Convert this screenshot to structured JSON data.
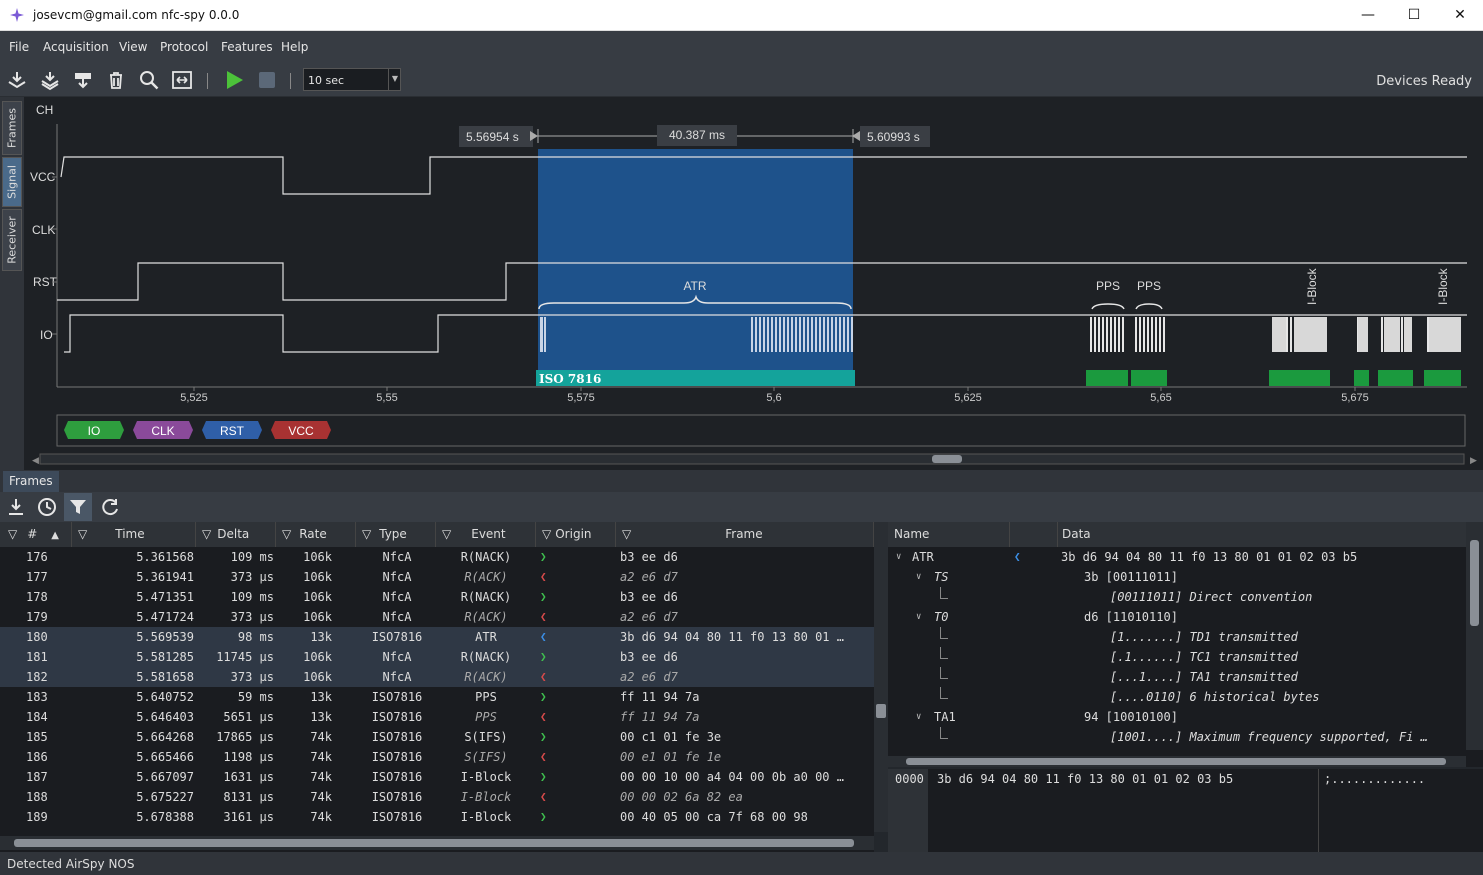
{
  "window": {
    "title": "josevcm@gmail.com nfc-spy 0.0.0"
  },
  "menu": [
    "File",
    "Acquisition",
    "View",
    "Protocol",
    "Features",
    "Help"
  ],
  "toolbar": {
    "duration": "10 sec",
    "status": "Devices Ready"
  },
  "side_tabs": [
    "Frames",
    "Signal",
    "Receiver"
  ],
  "signal": {
    "ch_label": "CH",
    "channels": [
      "VCC",
      "CLK",
      "RST",
      "IO"
    ],
    "marker_left": "5.56954 s",
    "marker_width": "40.387 ms",
    "marker_right": "5.60993 s",
    "atr_label": "ATR",
    "pps_labels": [
      "PPS",
      "PPS"
    ],
    "iblock_labels": [
      "I-Block",
      "I-Block"
    ],
    "protocol_label": "ISO 7816",
    "xticks": [
      "5,525",
      "5,55",
      "5,575",
      "5,6",
      "5,625",
      "5,65",
      "5,675"
    ],
    "legend": [
      "IO",
      "CLK",
      "RST",
      "VCC"
    ]
  },
  "frames_tab": "Frames",
  "table": {
    "headers": [
      "#",
      "Time",
      "Delta",
      "Rate",
      "Type",
      "Event",
      "Origin",
      "Frame"
    ],
    "rows": [
      [
        "176",
        "5.361568",
        "109 ms",
        "106k",
        "NfcA",
        "R(NACK)",
        "rx",
        "b3 ee d6",
        false,
        false
      ],
      [
        "177",
        "5.361941",
        "373 µs",
        "106k",
        "NfcA",
        "R(ACK)",
        "tx",
        "a2 e6 d7",
        true,
        false
      ],
      [
        "178",
        "5.471351",
        "109 ms",
        "106k",
        "NfcA",
        "R(NACK)",
        "rx",
        "b3 ee d6",
        false,
        false
      ],
      [
        "179",
        "5.471724",
        "373 µs",
        "106k",
        "NfcA",
        "R(ACK)",
        "tx",
        "a2 e6 d7",
        true,
        false
      ],
      [
        "180",
        "5.569539",
        "98 ms",
        "13k",
        "ISO7816",
        "ATR",
        "atr",
        "3b d6 94 04 80 11 f0 13 80 01 …",
        false,
        true
      ],
      [
        "181",
        "5.581285",
        "11745 µs",
        "106k",
        "NfcA",
        "R(NACK)",
        "rx",
        "b3 ee d6",
        false,
        true
      ],
      [
        "182",
        "5.581658",
        "373 µs",
        "106k",
        "NfcA",
        "R(ACK)",
        "tx",
        "a2 e6 d7",
        true,
        true
      ],
      [
        "183",
        "5.640752",
        "59 ms",
        "13k",
        "ISO7816",
        "PPS",
        "rx",
        "ff 11 94 7a",
        false,
        false
      ],
      [
        "184",
        "5.646403",
        "5651 µs",
        "13k",
        "ISO7816",
        "PPS",
        "tx",
        "ff 11 94 7a",
        true,
        false
      ],
      [
        "185",
        "5.664268",
        "17865 µs",
        "74k",
        "ISO7816",
        "S(IFS)",
        "rx",
        "00 c1 01 fe 3e",
        false,
        false
      ],
      [
        "186",
        "5.665466",
        "1198 µs",
        "74k",
        "ISO7816",
        "S(IFS)",
        "tx",
        "00 e1 01 fe 1e",
        true,
        false
      ],
      [
        "187",
        "5.667097",
        "1631 µs",
        "74k",
        "ISO7816",
        "I-Block",
        "rx",
        "00 00 10 00 a4 04 00 0b a0 00 …",
        false,
        false
      ],
      [
        "188",
        "5.675227",
        "8131 µs",
        "74k",
        "ISO7816",
        "I-Block",
        "tx",
        "00 00 02 6a 82 ea",
        true,
        false
      ],
      [
        "189",
        "5.678388",
        "3161 µs",
        "74k",
        "ISO7816",
        "I-Block",
        "rx",
        "00 40 05 00 ca 7f 68 00 98",
        false,
        false
      ]
    ]
  },
  "detail": {
    "headers": [
      "Name",
      "Data"
    ],
    "rows": [
      {
        "name": "ATR",
        "data": "3b d6 94 04 80 11 f0 13 80 01 01 02 03 b5",
        "lvl": 0,
        "italic": false
      },
      {
        "name": "TS",
        "data": "3b [00111011]",
        "lvl": 1,
        "italic": true
      },
      {
        "name": "",
        "data": "[00111011] Direct convention",
        "lvl": 2,
        "italic": true
      },
      {
        "name": "T0",
        "data": "d6 [11010110]",
        "lvl": 1,
        "italic": true
      },
      {
        "name": "",
        "data": "[1.......] TD1 transmitted",
        "lvl": 2,
        "italic": true
      },
      {
        "name": "",
        "data": "[.1......] TC1 transmitted",
        "lvl": 2,
        "italic": true
      },
      {
        "name": "",
        "data": "[...1....] TA1 transmitted",
        "lvl": 2,
        "italic": true
      },
      {
        "name": "",
        "data": "[....0110] 6 historical bytes",
        "lvl": 2,
        "italic": true
      },
      {
        "name": "TA1",
        "data": "94 [10010100]",
        "lvl": 1,
        "italic": false
      },
      {
        "name": "",
        "data": "[1001....] Maximum frequency supported, Fi …",
        "lvl": 2,
        "italic": true
      }
    ]
  },
  "hex": {
    "offset": "0000",
    "bytes": "3b d6 94 04 80 11 f0 13 80 01 01 02 03 b5",
    "ascii": ";............."
  },
  "statusbar": "Detected AirSpy NOS",
  "colors": {
    "rx": "#3fbf4f",
    "tx": "#d94a4a",
    "atr": "#3b8fe6",
    "legend_io": "#2e9e3e",
    "legend_clk": "#8a4a9a",
    "legend_rst": "#2f5fa8",
    "legend_vcc": "#a83232"
  }
}
